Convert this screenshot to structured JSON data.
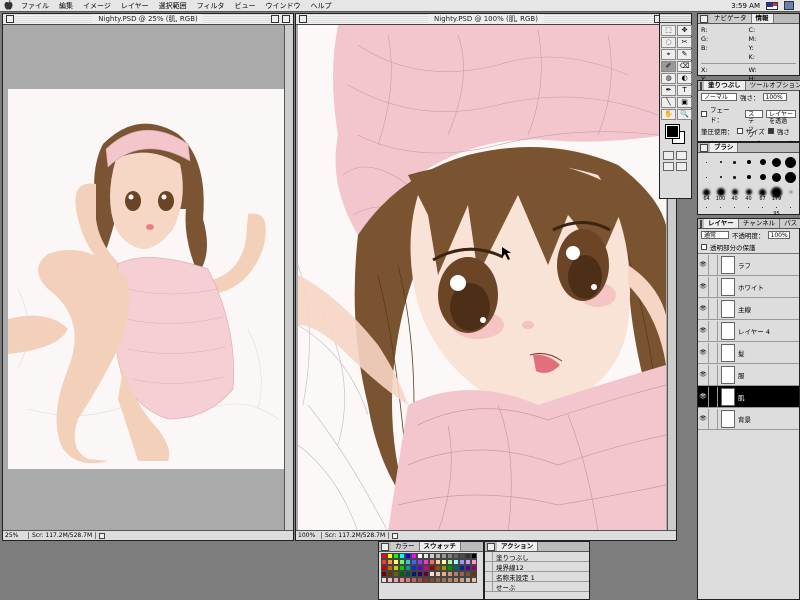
{
  "menubar": {
    "apple": "",
    "items": [
      "ファイル",
      "編集",
      "イメージ",
      "レイヤー",
      "選択範囲",
      "フィルタ",
      "ビュー",
      "ウインドウ",
      "ヘルプ"
    ],
    "clock": "3:59 AM"
  },
  "doc_small": {
    "title": "Nighty.PSD @ 25% (肌, RGB)",
    "zoom": "25%",
    "info": "Scr: 117.2M/528.7M"
  },
  "doc_large": {
    "title": "Nighty.PSD @ 100% (肌, RGB)",
    "zoom": "100%",
    "info": "Scr: 117.2M/528.7M"
  },
  "toolbox": {
    "tools": [
      "⬚",
      "✥",
      "◌",
      "✂",
      "⌖",
      "✎",
      "✐",
      "⌫",
      "◍",
      "◐",
      "✒",
      "T",
      "╲",
      "▣",
      "✋",
      "🔍"
    ],
    "colors": {
      "foreground": "#000000",
      "background": "#ffffff"
    }
  },
  "info_palette": {
    "tabs": [
      "ナビゲータ",
      "情報"
    ],
    "rows": [
      {
        "label": "R:",
        "value": "",
        "label2": "C:",
        "value2": ""
      },
      {
        "label": "G:",
        "value": "",
        "label2": "M:",
        "value2": ""
      },
      {
        "label": "B:",
        "value": "",
        "label2": "Y:",
        "value2": ""
      },
      {
        "label": "",
        "value": "",
        "label2": "K:",
        "value2": ""
      },
      {
        "label": "X:",
        "value": "",
        "label2": "W:",
        "value2": ""
      },
      {
        "label": "Y:",
        "value": "",
        "label2": "H:",
        "value2": ""
      }
    ]
  },
  "options_palette": {
    "tabs": [
      "塗りつぶし",
      "ツールオプション"
    ],
    "mode": "ノーマル",
    "opacity_label": "強さ：",
    "opacity_value": "100%",
    "fade_label": "フェード：",
    "fade_value": "ステップ",
    "layer_label": "レイヤーを透過",
    "stylus_label": "筆圧使用：",
    "size_label": "サイズ",
    "strength_label": "強さ",
    "wet_label": "ウエットエッジ",
    "sample_label": "全レイヤーを使用"
  },
  "brushes_palette": {
    "tabs": [
      "ブラシ"
    ],
    "brushes": [
      {
        "size": 1,
        "label": ""
      },
      {
        "size": 2,
        "label": ""
      },
      {
        "size": 3,
        "label": ""
      },
      {
        "size": 4,
        "label": ""
      },
      {
        "size": 6,
        "label": ""
      },
      {
        "size": 9,
        "label": ""
      },
      {
        "size": 11,
        "label": ""
      },
      {
        "size": 1,
        "label": ""
      },
      {
        "size": 2,
        "label": ""
      },
      {
        "size": 3,
        "label": ""
      },
      {
        "size": 4,
        "label": ""
      },
      {
        "size": 6,
        "label": ""
      },
      {
        "size": 9,
        "label": ""
      },
      {
        "size": 11,
        "label": ""
      },
      {
        "size": 7,
        "label": "64"
      },
      {
        "size": 8,
        "label": "100"
      },
      {
        "size": 6,
        "label": "40"
      },
      {
        "size": 6,
        "label": "40"
      },
      {
        "size": 7,
        "label": "67"
      },
      {
        "size": 11,
        "label": "179"
      },
      {
        "size": 2,
        "label": ""
      },
      {
        "size": 1,
        "label": ""
      },
      {
        "size": 1,
        "label": ""
      },
      {
        "size": 1,
        "label": ""
      },
      {
        "size": 1,
        "label": ""
      },
      {
        "size": 1,
        "label": ""
      },
      {
        "size": 1,
        "label": "95"
      },
      {
        "size": 1,
        "label": ""
      }
    ]
  },
  "layers_palette": {
    "tabs": [
      "レイヤー",
      "チャンネル",
      "パス"
    ],
    "mode": "通常",
    "opacity_label": "不透明度：",
    "opacity_value": "100%",
    "preserve_label": "透明部分の保護",
    "layers": [
      {
        "name": "ラフ",
        "active": false
      },
      {
        "name": "ホワイト",
        "active": false
      },
      {
        "name": "主線",
        "active": false
      },
      {
        "name": "レイヤー 4",
        "active": false
      },
      {
        "name": "髪",
        "active": false
      },
      {
        "name": "服",
        "active": false
      },
      {
        "name": "肌",
        "active": true
      },
      {
        "name": "背景",
        "active": false
      }
    ]
  },
  "swatches_palette": {
    "tabs": [
      "カラー",
      "スウォッチ"
    ],
    "colors": [
      "#ff0000",
      "#ffff00",
      "#00ff00",
      "#00ffff",
      "#0000ff",
      "#ff00ff",
      "#ffffff",
      "#e6e6e6",
      "#cccccc",
      "#b3b3b3",
      "#999999",
      "#808080",
      "#666666",
      "#4d4d4d",
      "#333333",
      "#000000",
      "#ff3333",
      "#ff9933",
      "#ffff66",
      "#66ff66",
      "#33cccc",
      "#3366ff",
      "#9933ff",
      "#ff33cc",
      "#ff6666",
      "#ffcc99",
      "#ffff99",
      "#99ff99",
      "#99ffff",
      "#9999ff",
      "#cc99ff",
      "#ff99cc",
      "#cc0000",
      "#cc6600",
      "#cccc00",
      "#00cc00",
      "#009999",
      "#0033cc",
      "#6600cc",
      "#cc0099",
      "#990000",
      "#994c00",
      "#999900",
      "#009900",
      "#006666",
      "#002699",
      "#4c0099",
      "#990066",
      "#660000",
      "#663300",
      "#666600",
      "#006600",
      "#004d4d",
      "#001a66",
      "#330066",
      "#660033",
      "#ffe0d0",
      "#f0c8b0",
      "#e0b090",
      "#c89878",
      "#b08060",
      "#986848",
      "#805030",
      "#603820",
      "#f5d6d6",
      "#f0c0c0",
      "#e8a8a8",
      "#e09090",
      "#d87878",
      "#c06060",
      "#a84848",
      "#903030",
      "#7a5030",
      "#8a6040",
      "#9a7050",
      "#aa8060",
      "#ba9070",
      "#caa080",
      "#dab090",
      "#eac0a0"
    ]
  },
  "actions_palette": {
    "tabs": [
      "アクション"
    ],
    "actions": [
      "塗りつぶし",
      "境界線12",
      "名称未設定 1",
      "せーぶ"
    ]
  }
}
